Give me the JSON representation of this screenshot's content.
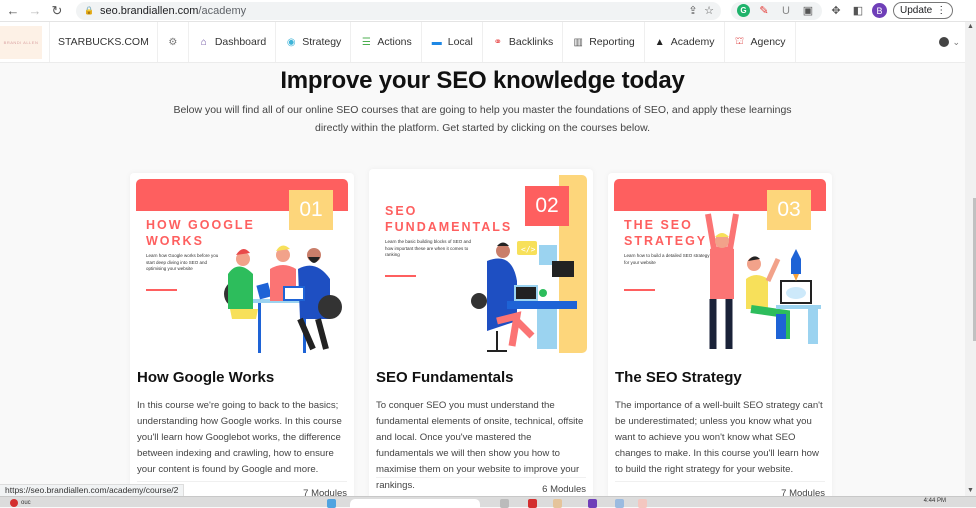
{
  "browser": {
    "url_domain": "seo.brandiallen.com",
    "url_path": "/academy",
    "update_label": "Update",
    "profile_initial": "B",
    "icons": [
      "back-icon",
      "forward-icon",
      "reload-icon",
      "lock-icon",
      "share-icon",
      "star-icon",
      "grammarly-extension-icon",
      "pen-extension-icon",
      "u-extension-icon",
      "camera-extension-icon",
      "puzzle-extensions-icon",
      "sidepanel-icon",
      "menu-dots-icon"
    ]
  },
  "appnav": {
    "logo_text": "BRANDI ALLEN",
    "site": "STARBUCKS.COM",
    "items": [
      {
        "label": "Dashboard",
        "icon": "home-icon",
        "glyph": "⌂",
        "color": "#6a4ea0"
      },
      {
        "label": "Strategy",
        "icon": "strategy-icon",
        "glyph": "◉",
        "color": "#3fb4d8"
      },
      {
        "label": "Actions",
        "icon": "list-icon",
        "glyph": "☰",
        "color": "#4caf50"
      },
      {
        "label": "Local",
        "icon": "store-icon",
        "glyph": "▬",
        "color": "#1e88e5"
      },
      {
        "label": "Backlinks",
        "icon": "link-icon",
        "glyph": "⚭",
        "color": "#e84a4a"
      },
      {
        "label": "Reporting",
        "icon": "chart-icon",
        "glyph": "▥",
        "color": "#555555"
      },
      {
        "label": "Academy",
        "icon": "graduation-cap-icon",
        "glyph": "🎓",
        "color": "#222222"
      },
      {
        "label": "Agency",
        "icon": "agency-icon",
        "glyph": "⛫",
        "color": "#e46a6a"
      }
    ]
  },
  "page": {
    "title": "Improve your SEO knowledge today",
    "subtitle": "Below you will find all of our online SEO courses that are going to help you master the foundations of SEO, and apply these learnings directly within the platform. Get started by clicking on the courses below."
  },
  "courses": [
    {
      "number": "01",
      "thumb_title_line1": "HOW GOOGLE",
      "thumb_title_line2": "WORKS",
      "thumb_desc": "Learn how Google works before you start deep diving into SEO and optimising your website",
      "title": "How Google Works",
      "description": "In this course we're going to back to the basics; understanding how Google works. In this course you'll learn how Googlebot works, the difference between indexing and crawling, how to ensure your content is found by Google and more.",
      "modules": "7 Modules"
    },
    {
      "number": "02",
      "thumb_title_line1": "SEO",
      "thumb_title_line2": "FUNDAMENTALS",
      "thumb_desc": "Learn the basic building blocks of SEO and how important these are when it comes to ranking",
      "title": "SEO Fundamentals",
      "description": "To conquer SEO you must understand the fundamental elements of onsite, technical, offsite and local. Once you've mastered the fundamentals we will then show you how to maximise them on your website to improve your rankings.",
      "modules": "6 Modules"
    },
    {
      "number": "03",
      "thumb_title_line1": "THE SEO",
      "thumb_title_line2": "STRATEGY",
      "thumb_desc": "Learn how to build a detailed SEO strategy for your website",
      "title": "The SEO Strategy",
      "description": "The importance of a well-built SEO strategy can't be underestimated; unless you know what you want to achieve you won't know what SEO changes to make. In this course you'll learn how to build the right strategy for your website.",
      "modules": "7 Modules"
    }
  ],
  "status_bar": {
    "hover_url": "https://seo.brandiallen.com/academy/course/2"
  },
  "taskbar": {
    "weather_badge": "1",
    "weather_text": "ouc",
    "clock": "4:44 PM"
  },
  "colors": {
    "brand_red": "#fe5f5f",
    "brand_yellow": "#fdd67b"
  }
}
